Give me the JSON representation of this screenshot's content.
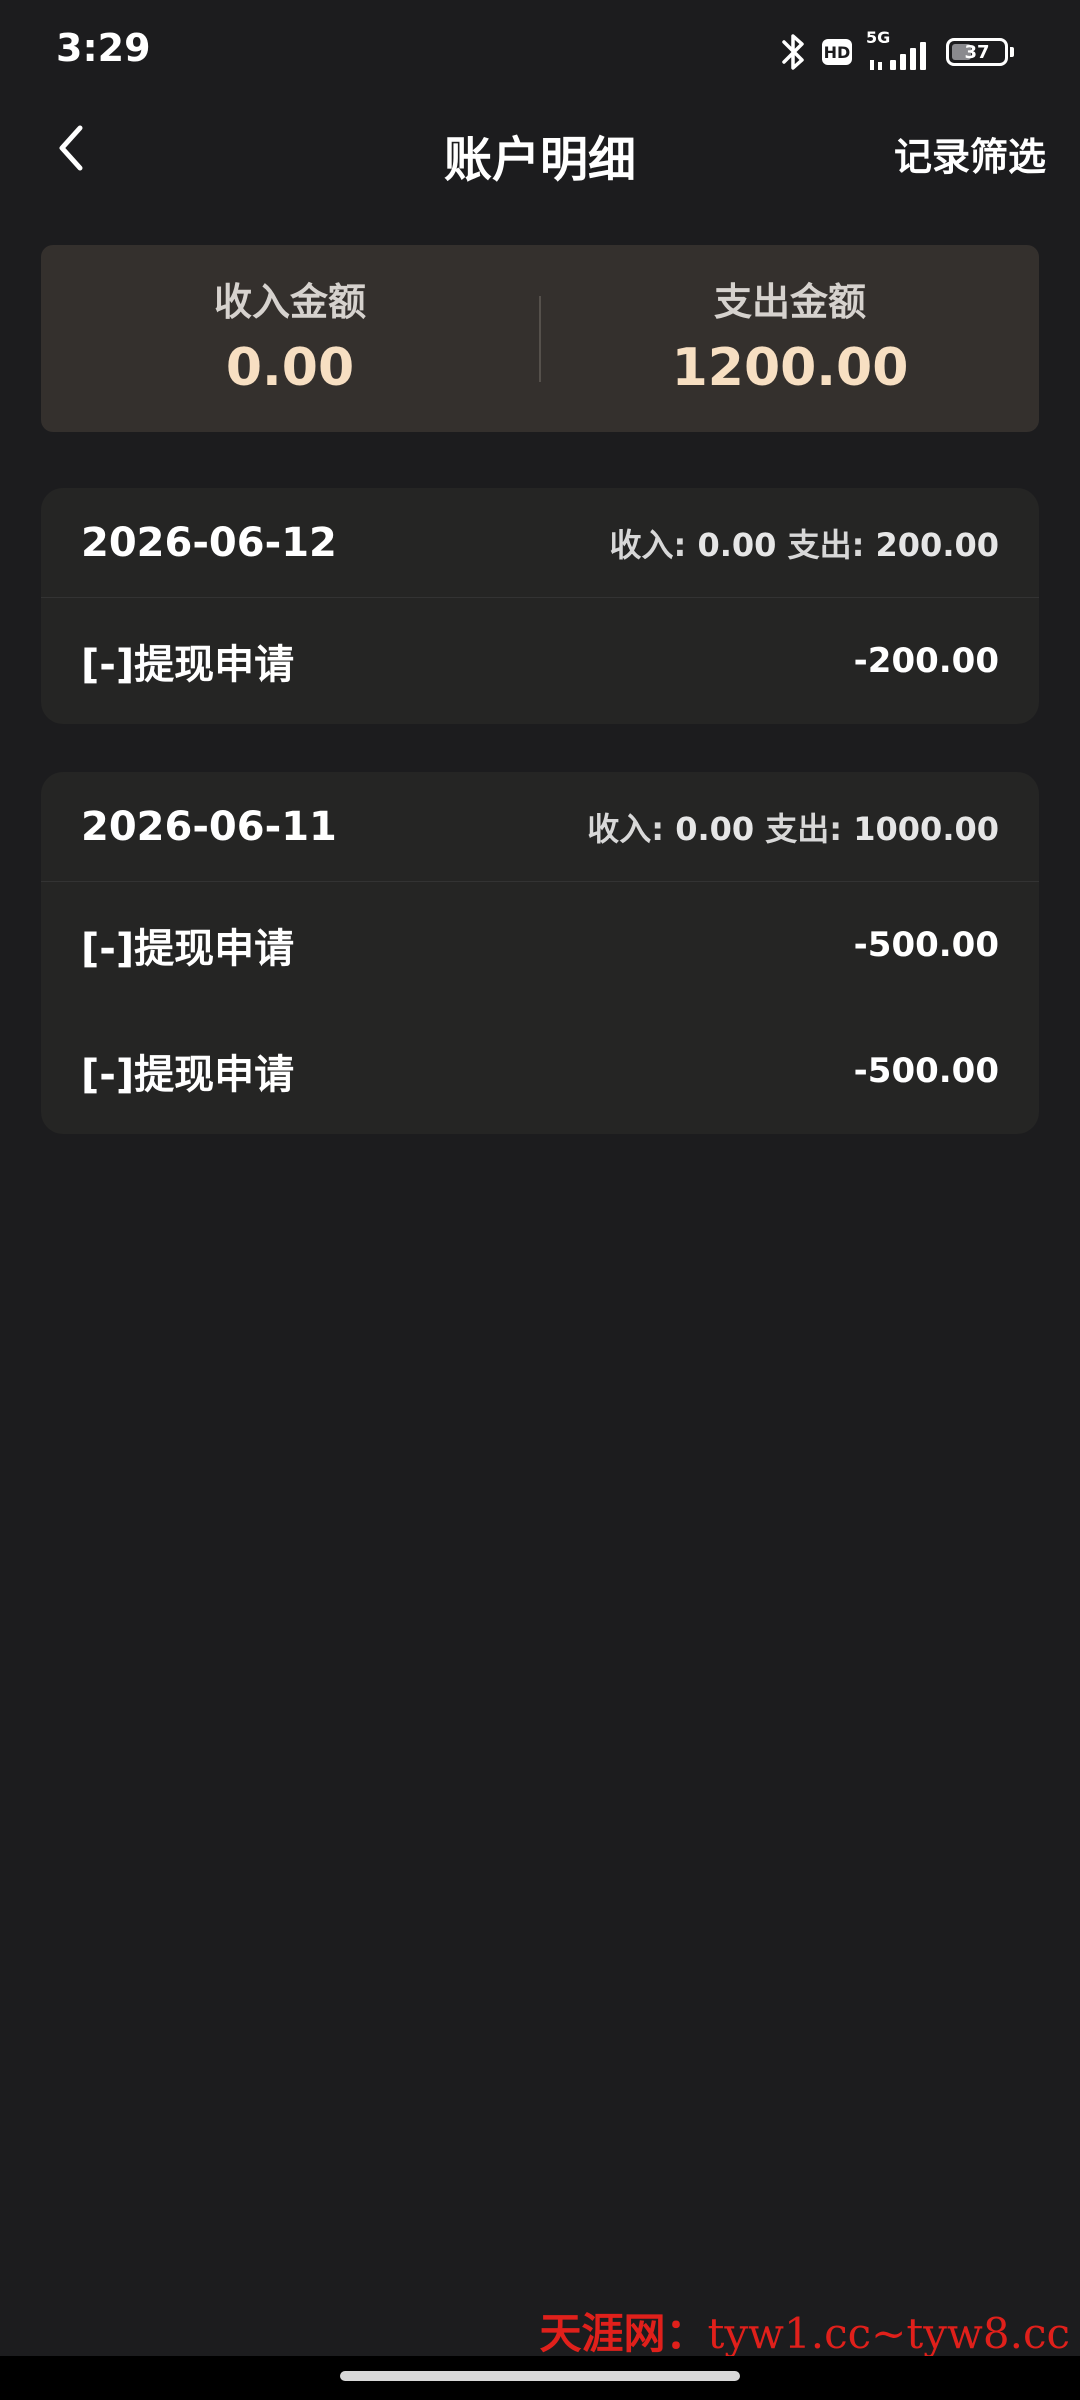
{
  "status_bar": {
    "time": "3:29",
    "network": "5G",
    "hd": "HD",
    "battery": "37",
    "battery_level": 0.37,
    "icons": [
      "bluetooth-icon",
      "hd-icon",
      "signal-icon",
      "battery-icon"
    ]
  },
  "nav": {
    "title": "账户明细",
    "filter_label": "记录筛选",
    "back_icon": "chevron-left-icon"
  },
  "summary": {
    "income_label": "收入金额",
    "income_value": "0.00",
    "expense_label": "支出金额",
    "expense_value": "1200.00"
  },
  "groups": [
    {
      "date": "2026-06-12",
      "income_label": "收入:",
      "income": "0.00",
      "expense_label": "支出:",
      "expense": "200.00",
      "records": [
        {
          "title": "[-]提现申请",
          "amount": "-200.00"
        }
      ]
    },
    {
      "date": "2026-06-11",
      "income_label": "收入:",
      "income": "0.00",
      "expense_label": "支出:",
      "expense": "1000.00",
      "records": [
        {
          "title": "[-]提现申请",
          "amount": "-500.00"
        },
        {
          "title": "[-]提现申请",
          "amount": "-500.00"
        }
      ]
    }
  ],
  "watermark": {
    "cn": "天涯网：",
    "url": "tyw1.cc~tyw8.cc"
  },
  "colors": {
    "background": "#1c1c1e",
    "summary_card": "#34302d",
    "summary_value": "#f7dfc2",
    "day_card": "#252524",
    "watermark": "#e0201b"
  }
}
